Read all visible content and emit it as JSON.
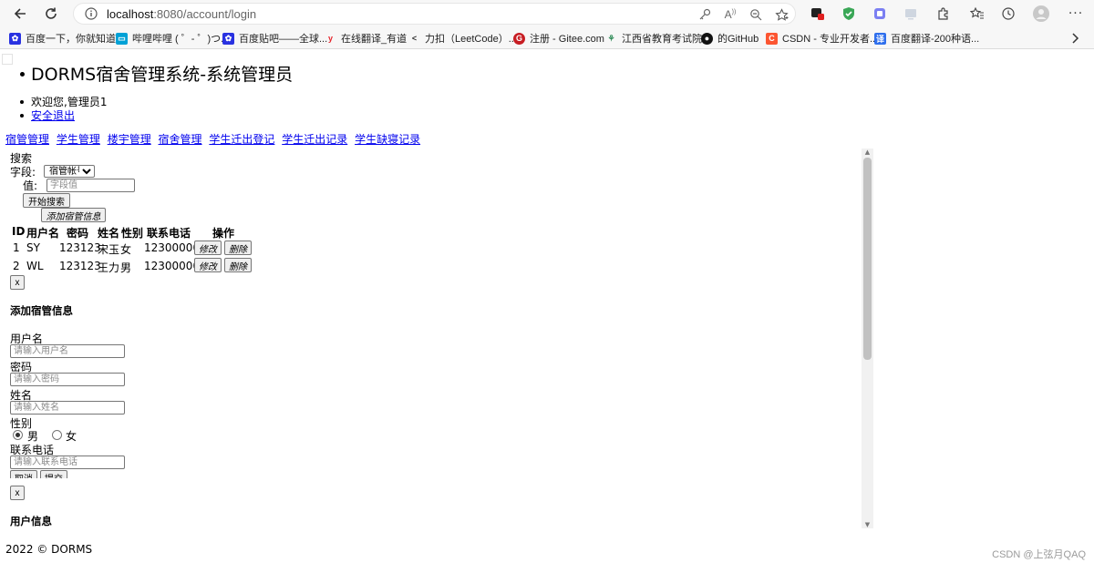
{
  "browser": {
    "url_host": "localhost",
    "url_rest": ":8080/account/login",
    "bookmarks": [
      {
        "label": "百度一下，你就知道",
        "icon": "baidu-paw-icon",
        "color": "#2932e1"
      },
      {
        "label": "哔哩哔哩 ( ゜- ゜)つ...",
        "icon": "bilibili-tv-icon",
        "color": "#00a1d6"
      },
      {
        "label": "百度贴吧——全球...",
        "icon": "baidu-paw-icon",
        "color": "#2932e1"
      },
      {
        "label": "在线翻译_有道",
        "icon": "youdao-y-icon",
        "color": "#e5242b"
      },
      {
        "label": "力扣（LeetCode）...",
        "icon": "leetcode-icon",
        "color": "#333333"
      },
      {
        "label": "注册 - Gitee.com",
        "icon": "gitee-icon",
        "color": "#c71d23"
      },
      {
        "label": "江西省教育考试院",
        "icon": "jx-education-icon",
        "color": "#2e8b57"
      },
      {
        "label": "的GitHub",
        "icon": "github-icon",
        "color": "#111111"
      },
      {
        "label": "CSDN - 专业开发者...",
        "icon": "csdn-c-icon",
        "color": "#fc5531"
      },
      {
        "label": "百度翻译-200种语...",
        "icon": "baidu-translate-icon",
        "color": "#2f6fed"
      }
    ]
  },
  "header": {
    "title": "DORMS宿舍管理系统-系统管理员",
    "welcome": "欢迎您,管理员1",
    "logout": "安全退出"
  },
  "nav": [
    "宿管管理",
    "学生管理",
    "楼宇管理",
    "宿舍管理",
    "学生迁出登记",
    "学生迁出记录",
    "学生缺寝记录"
  ],
  "search": {
    "heading": "搜索",
    "field_label": "字段:",
    "field_selected": "宿管帐号",
    "value_label": "值:",
    "value_placeholder": "字段值",
    "search_button": "开始搜索",
    "add_button": "添加宿管信息"
  },
  "table": {
    "headers": [
      "ID",
      "用户名",
      "密码",
      "姓名",
      "性别",
      "联系电话",
      "操作"
    ],
    "rows": [
      {
        "id": "1",
        "username": "SY",
        "password": "123123",
        "name": "宋玉",
        "gender": "女",
        "phone": "12300000"
      },
      {
        "id": "2",
        "username": "WL",
        "password": "123123",
        "name": "王力",
        "gender": "男",
        "phone": "12300000"
      }
    ],
    "edit_label": "修改",
    "delete_label": "删除"
  },
  "close_label": "x",
  "add_form": {
    "title": "添加宿管信息",
    "username_label": "用户名",
    "username_placeholder": "请输入用户名",
    "password_label": "密码",
    "password_placeholder": "请输入密码",
    "name_label": "姓名",
    "name_placeholder": "请输入姓名",
    "gender_label": "性别",
    "gender_options": [
      "男",
      "女"
    ],
    "gender_selected": "男",
    "phone_label": "联系电话",
    "phone_placeholder": "请输入联系电话",
    "cancel_button": "取消",
    "submit_button": "提交"
  },
  "user_info_title": "用户信息",
  "footer": "2022 © DORMS",
  "watermark": "CSDN @上弦月QAQ"
}
